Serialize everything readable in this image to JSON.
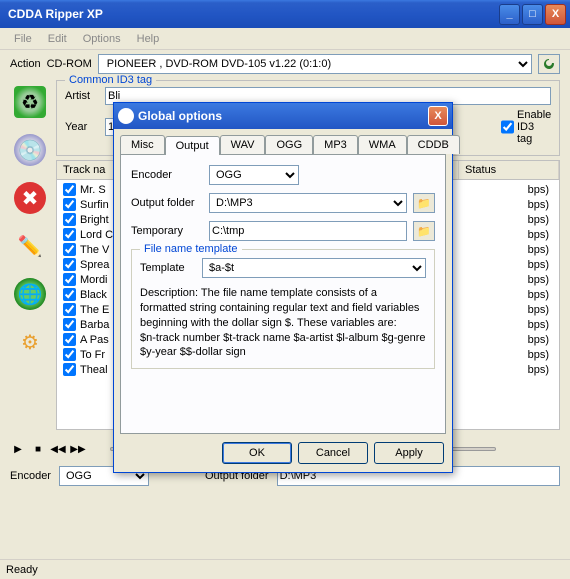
{
  "window": {
    "title": "CDDA Ripper XP"
  },
  "menu": {
    "file": "File",
    "edit": "Edit",
    "options": "Options",
    "help": "Help"
  },
  "action": {
    "label": "Action",
    "cdrom_label": "CD-ROM",
    "cdrom_value": "PIONEER , DVD-ROM DVD-105  v1.22 (0:1:0)"
  },
  "id3": {
    "legend": "Common ID3 tag",
    "artist_label": "Artist",
    "artist_value": "Bli",
    "year_label": "Year",
    "year_value": "19",
    "enable_label": "Enable ID3 tag"
  },
  "tracks": {
    "header_name": "Track na",
    "header_status": "Status",
    "items": [
      {
        "name": "Mr. S",
        "suffix": "bps)"
      },
      {
        "name": "Surfin",
        "suffix": "bps)"
      },
      {
        "name": "Bright",
        "suffix": "bps)"
      },
      {
        "name": "Lord C",
        "suffix": "bps)"
      },
      {
        "name": "The V",
        "suffix": "bps)"
      },
      {
        "name": "Sprea",
        "suffix": "bps)"
      },
      {
        "name": "Mordi",
        "suffix": "bps)"
      },
      {
        "name": "Black",
        "suffix": "bps)"
      },
      {
        "name": "The E",
        "suffix": "bps)"
      },
      {
        "name": "Barba",
        "suffix": "bps)"
      },
      {
        "name": "A Pas",
        "suffix": "bps)"
      },
      {
        "name": "To Fr",
        "suffix": "bps)"
      },
      {
        "name": "Theal",
        "suffix": "bps)"
      }
    ]
  },
  "bottom": {
    "encoder_label": "Encoder",
    "encoder_value": "OGG",
    "output_label": "Output folder",
    "output_value": "D:\\MP3"
  },
  "status": {
    "text": "Ready"
  },
  "dialog": {
    "title": "Global options",
    "tabs": [
      "Misc",
      "Output",
      "WAV",
      "OGG",
      "MP3",
      "WMA",
      "CDDB"
    ],
    "active_tab": 1,
    "encoder_label": "Encoder",
    "encoder_value": "OGG",
    "output_label": "Output folder",
    "output_value": "D:\\MP3",
    "temp_label": "Temporary",
    "temp_value": "C:\\tmp",
    "template_legend": "File name template",
    "template_label": "Template",
    "template_value": "$a-$t",
    "desc": "Description: The file name template consists of a formatted string containing regular text and field variables beginning with the dollar sign $. These variables are:\n$n-track number $t-track name $a-artist $l-album $g-genre $y-year $$-dollar sign",
    "buttons": {
      "ok": "OK",
      "cancel": "Cancel",
      "apply": "Apply"
    }
  },
  "icons": {
    "minimize": "_",
    "maximize": "□",
    "close": "X",
    "folder": "📁"
  }
}
